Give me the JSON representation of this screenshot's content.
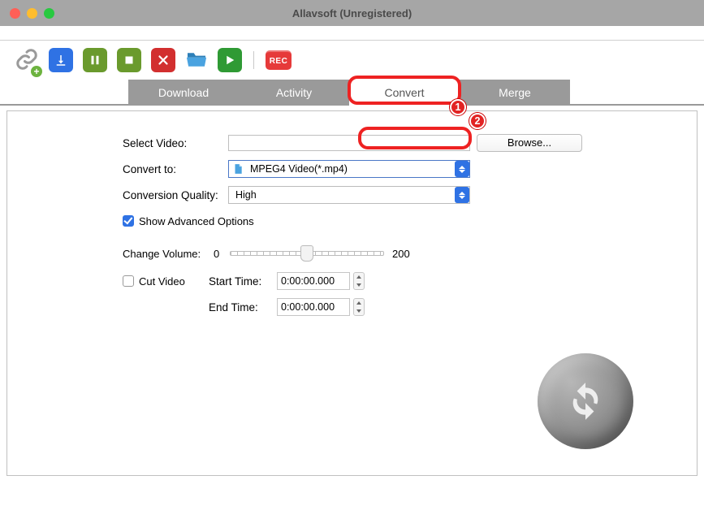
{
  "window": {
    "title": "Allavsoft (Unregistered)"
  },
  "toolbar": {
    "rec_label": "REC"
  },
  "tabs": {
    "download": "Download",
    "activity": "Activity",
    "convert": "Convert",
    "merge": "Merge"
  },
  "form": {
    "select_video_lbl": "Select Video:",
    "browse_btn": "Browse...",
    "convert_to_lbl": "Convert to:",
    "convert_to_value": "MPEG4 Video(*.mp4)",
    "quality_lbl": "Conversion Quality:",
    "quality_value": "High",
    "show_advanced": "Show Advanced Options",
    "volume_lbl": "Change Volume:",
    "volume_min": "0",
    "volume_max": "200",
    "cut_video": "Cut Video",
    "start_time_lbl": "Start Time:",
    "end_time_lbl": "End Time:",
    "start_time": "0:00:00.000",
    "end_time": "0:00:00.000"
  },
  "annotations": {
    "a1": "1",
    "a2": "2"
  }
}
